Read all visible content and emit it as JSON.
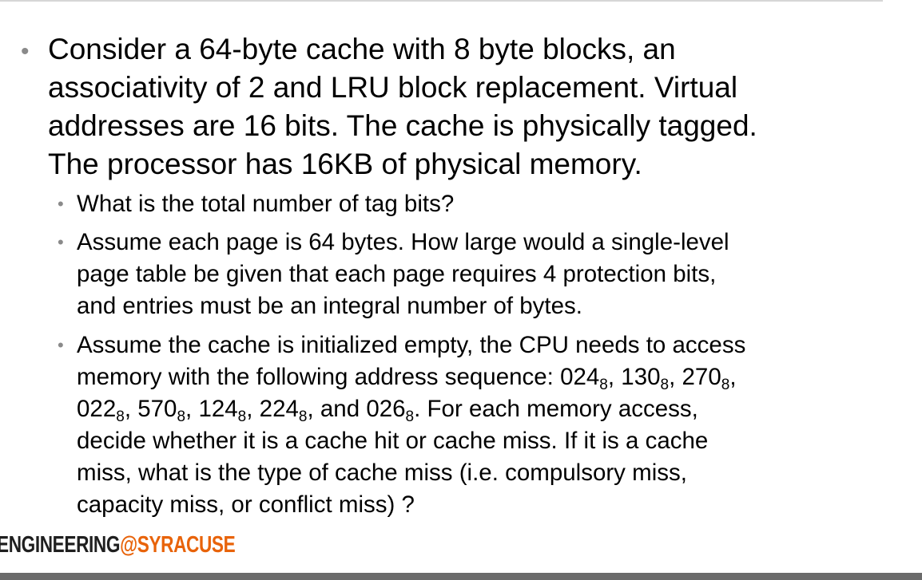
{
  "main_bullet": {
    "line1": "Consider a 64-byte cache with 8 byte blocks, an",
    "line2": "associativity of 2 and LRU block replacement. Virtual",
    "line3": "addresses are 16 bits. The cache is physically tagged.",
    "line4": "The processor has 16KB of physical memory."
  },
  "sub_bullets": {
    "q1": {
      "line1": "What is the total number of tag bits?"
    },
    "q2": {
      "line1": "Assume each page is 64 bytes. How large would a single-level",
      "line2": "page table be given that each page requires 4 protection bits,",
      "line3": "and entries must be an integral number of bytes."
    },
    "q3": {
      "line1": "Assume the cache is initialized empty, the CPU needs to access",
      "line2_prefix": "memory with the following address sequence: ",
      "addresses": [
        "024",
        "130",
        "270",
        "022",
        "570",
        "124",
        "224",
        "026"
      ],
      "base": "8",
      "line3_suffix": ". For each memory access,",
      "and_word": "and",
      "line4": "decide whether it is a cache hit or cache miss. If it is a cache",
      "line5": "miss, what is the type of cache miss (i.e. compulsory miss,",
      "line6": "capacity miss, or conflict miss) ?"
    }
  },
  "logo": {
    "part1": "ENGINEERING",
    "part2": "@",
    "part3": "SYRACUSE"
  },
  "colors": {
    "bullet": "#8a8a8a",
    "logo_accent": "#e8630a",
    "bottom_band": "#6b6b6b"
  }
}
